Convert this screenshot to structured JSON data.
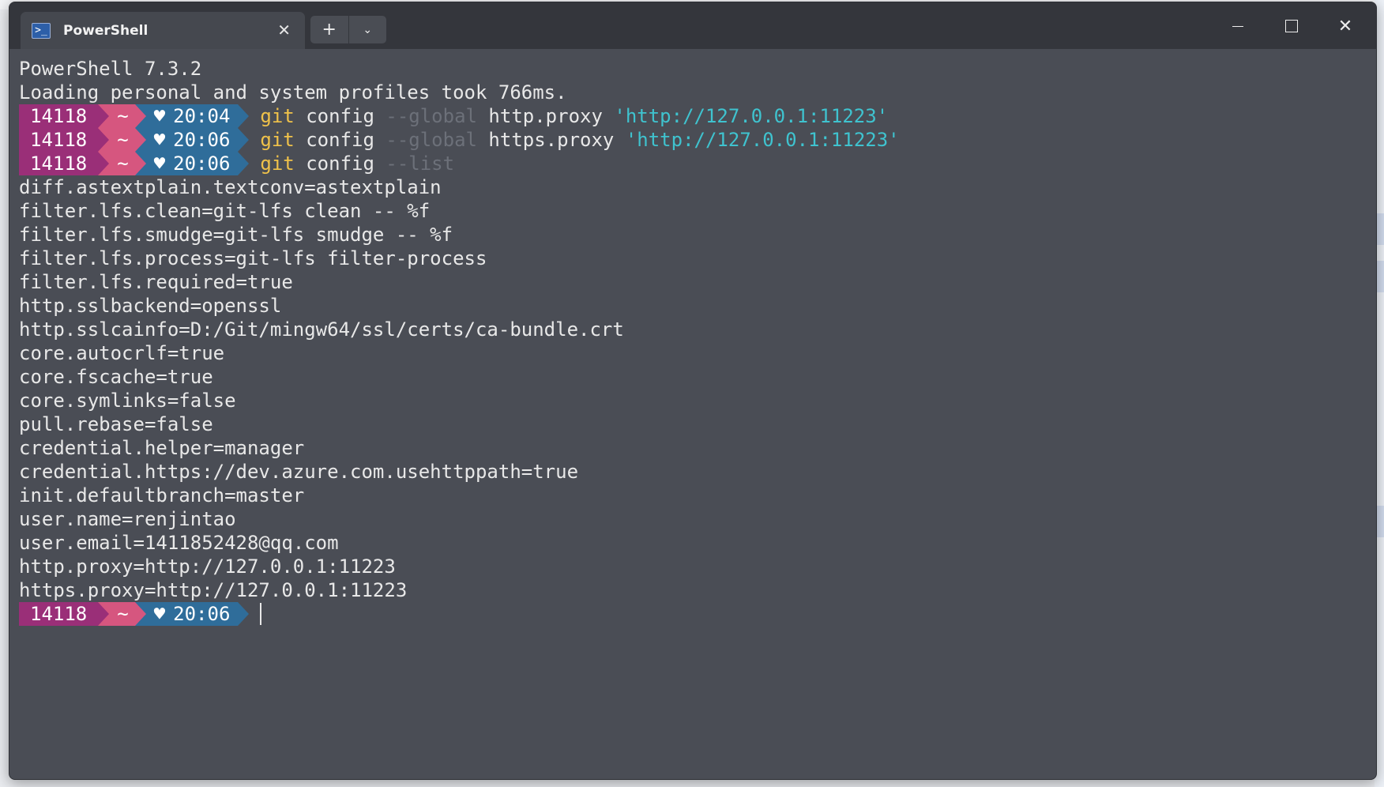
{
  "window": {
    "tab_title": "PowerShell",
    "tab_icon": "powershell-icon",
    "new_tab_symbol": "+",
    "dropdown_symbol": "⌄",
    "close_symbol": "✕"
  },
  "prompt": {
    "pid": "14118",
    "dir": "~",
    "heart": "♥",
    "colors": {
      "pid": "#9a2f78",
      "dir": "#d6567f",
      "time": "#2f6d9a"
    }
  },
  "terminal": {
    "banner1": "PowerShell 7.3.2",
    "banner2": "Loading personal and system profiles took 766ms.",
    "commands": [
      {
        "time": "20:04",
        "git": "git",
        "verb": "config",
        "flag": "--global",
        "key": "http.proxy",
        "value": "'http://127.0.0.1:11223'"
      },
      {
        "time": "20:06",
        "git": "git",
        "verb": "config",
        "flag": "--global",
        "key": "https.proxy",
        "value": "'http://127.0.0.1:11223'"
      },
      {
        "time": "20:06",
        "git": "git",
        "verb": "config",
        "flag": "--list"
      }
    ],
    "output": [
      "diff.astextplain.textconv=astextplain",
      "filter.lfs.clean=git-lfs clean -- %f",
      "filter.lfs.smudge=git-lfs smudge -- %f",
      "filter.lfs.process=git-lfs filter-process",
      "filter.lfs.required=true",
      "http.sslbackend=openssl",
      "http.sslcainfo=D:/Git/mingw64/ssl/certs/ca-bundle.crt",
      "core.autocrlf=true",
      "core.fscache=true",
      "core.symlinks=false",
      "pull.rebase=false",
      "credential.helper=manager",
      "credential.https://dev.azure.com.usehttppath=true",
      "init.defaultbranch=master",
      "user.name=renjintao",
      "user.email=1411852428@qq.com",
      "http.proxy=http://127.0.0.1:11223",
      "https.proxy=http://127.0.0.1:11223"
    ],
    "final_prompt_time": "20:06"
  }
}
